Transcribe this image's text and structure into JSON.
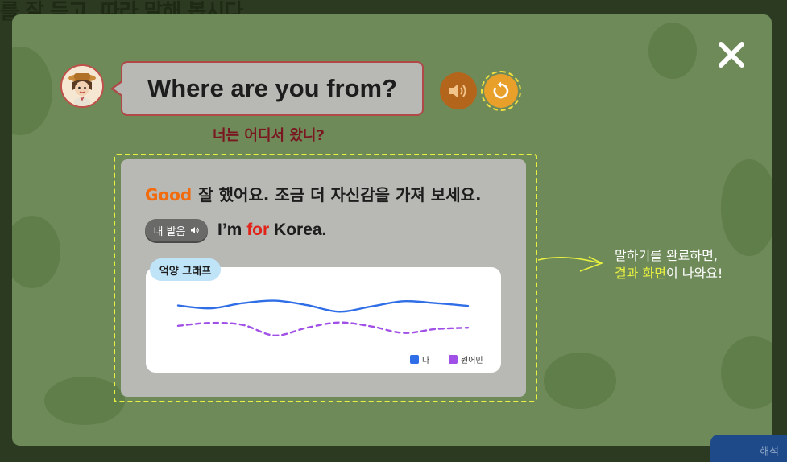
{
  "background": {
    "title": "를 잘 듣고, 따라 말해 봅시다"
  },
  "prompt": {
    "sentence": "Where are you from?",
    "translation": "너는 어디서 왔니?"
  },
  "result": {
    "grade": "Good",
    "feedback": "잘 했어요. 조금 더 자신감을 가져 보세요.",
    "my_pronunciation_label": "내 발음",
    "answer_words": {
      "before": "I’m ",
      "wrong": "for",
      "after": " Korea."
    },
    "graph": {
      "tag": "억양 그래프",
      "legend_me": "나",
      "legend_native": "원어민"
    }
  },
  "annotation": {
    "line1": "말하기를 완료하면,",
    "line2_highlight": "결과 화면",
    "line2_rest": "이 나와요!"
  },
  "corner_button": {
    "label": "해석"
  },
  "colors": {
    "overlay": "#6e8a58",
    "good": "#f26b0c",
    "wrong_word": "#e2231a",
    "series_me": "#2f6ee6",
    "series_native": "#a050e6",
    "highlight": "#e8f040"
  },
  "icons": {
    "close": "close-icon",
    "speaker": "speaker-icon",
    "replay": "replay-icon"
  },
  "chart_data": {
    "type": "line",
    "xlabel": "",
    "ylabel": "",
    "grid": false,
    "legend": "bottom-right",
    "series": [
      {
        "name": "나",
        "values": [
          0.6,
          0.45,
          0.72,
          0.85,
          0.62,
          0.28,
          0.55,
          0.82,
          0.72,
          0.58
        ]
      },
      {
        "name": "원어민",
        "values": [
          -0.45,
          -0.3,
          -0.4,
          -0.95,
          -0.55,
          -0.28,
          -0.48,
          -0.82,
          -0.62,
          -0.55
        ]
      }
    ]
  }
}
